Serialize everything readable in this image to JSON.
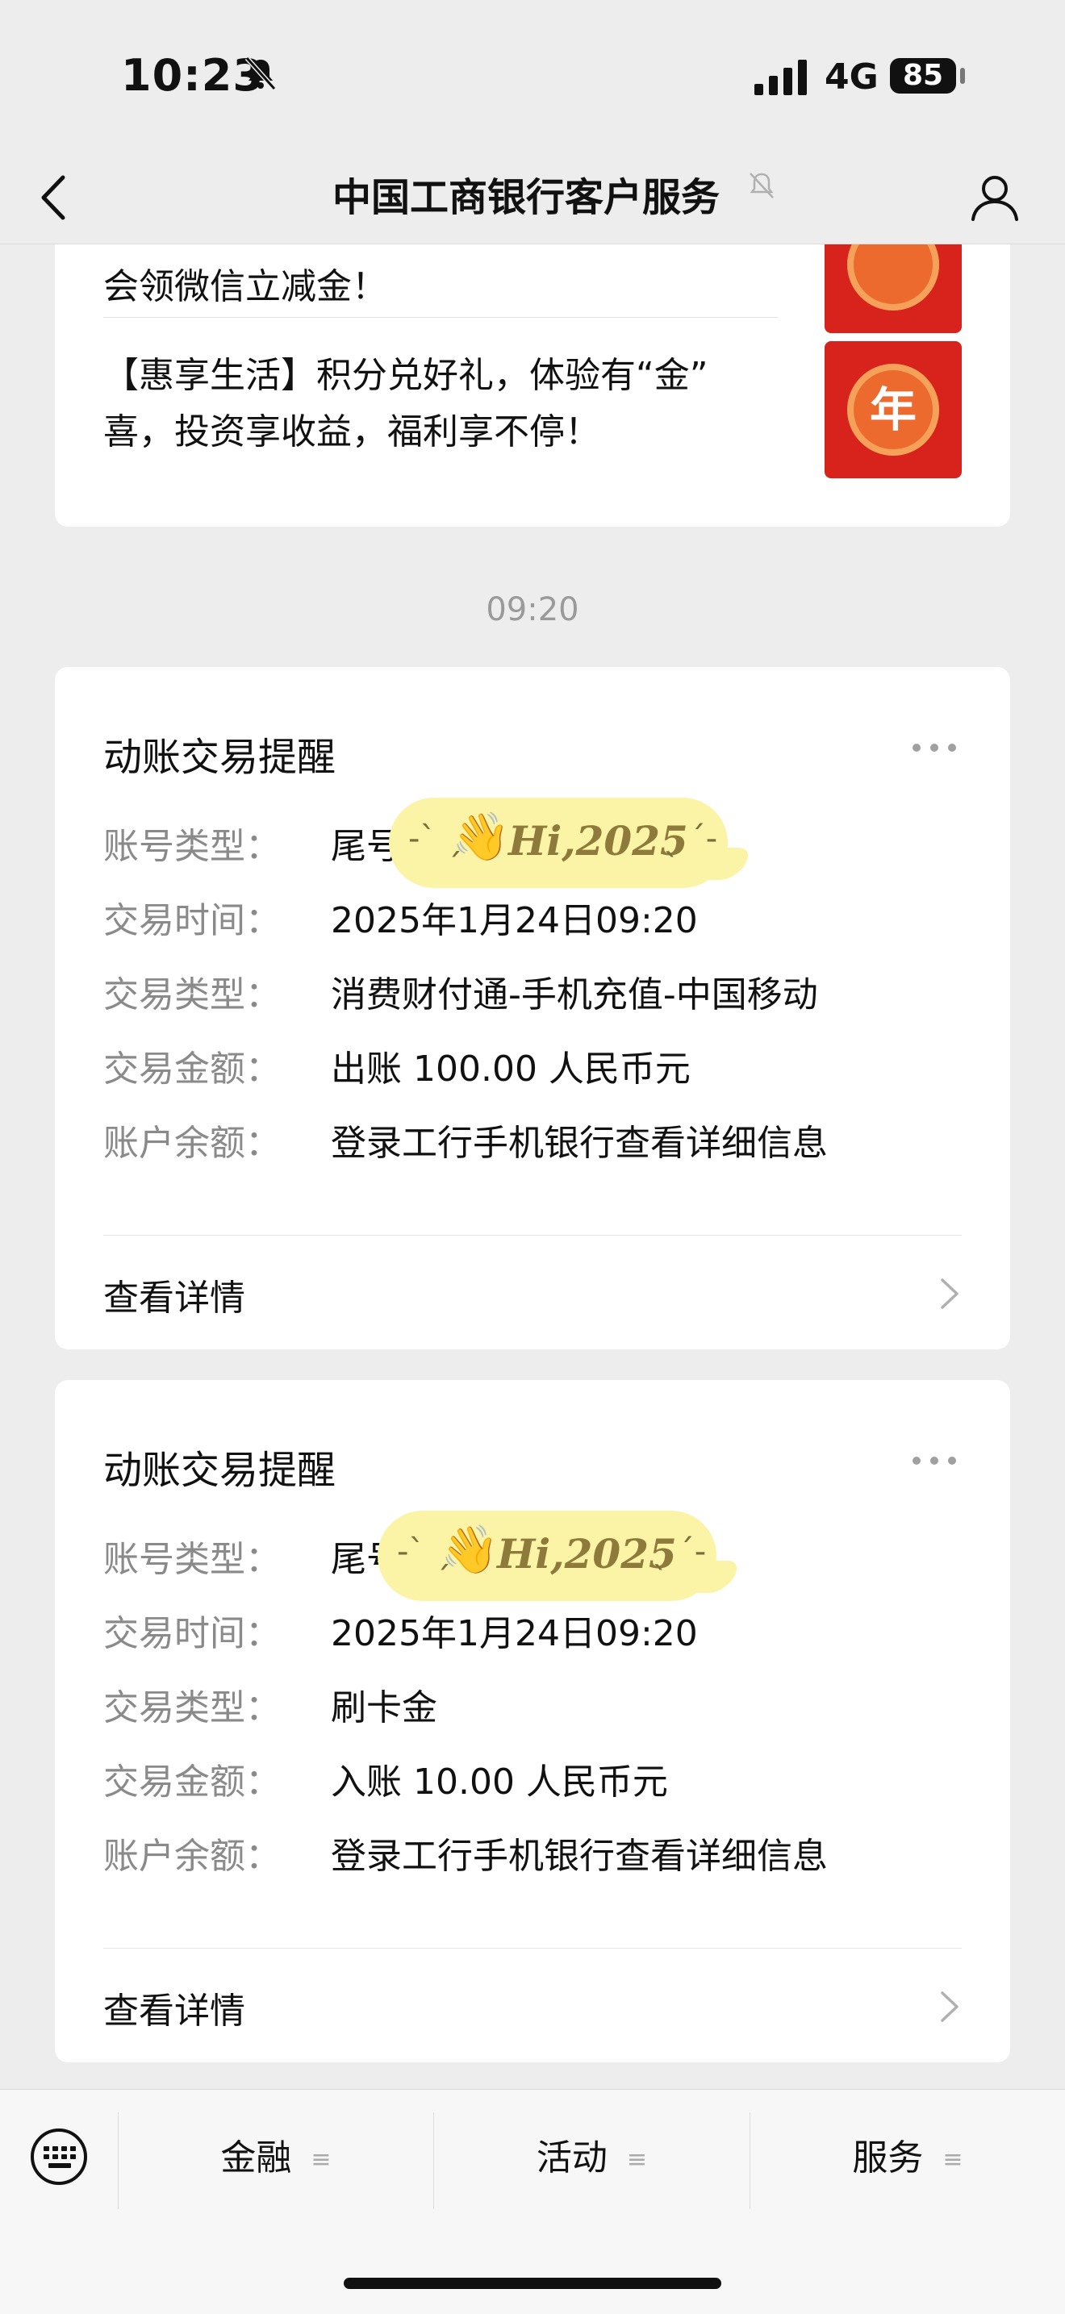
{
  "status_bar": {
    "time": "10:23",
    "network": "4G",
    "battery": "85",
    "icons": [
      "bell-muted-icon",
      "signal-icon",
      "battery-icon"
    ]
  },
  "nav": {
    "title": "中国工商银行客户服务",
    "icons": [
      "back-icon",
      "muted-bell-icon",
      "user-icon"
    ]
  },
  "news": {
    "item1_tail": "会领微信立减金！",
    "item2_line1": "【惠享生活】积分兑好礼，体验有“金”",
    "item2_line2": "喜，投资享收益，福利享不停！",
    "thumb_char": "年"
  },
  "timestamp": "09:20",
  "sticker": {
    "prefix": "尾号",
    "left_dash": "-ˋ ˏ",
    "hi": "Hi,2025",
    "right_dash": "ˎ ˊ-"
  },
  "transactions": [
    {
      "title": "动账交易提醒",
      "rows": [
        {
          "label": "账号类型：",
          "value": "尾号"
        },
        {
          "label": "交易时间：",
          "value": "2025年1月24日09:20"
        },
        {
          "label": "交易类型：",
          "value": "消费财付通-手机充值-中国移动"
        },
        {
          "label": "交易金额：",
          "value": "出账 100.00 人民币元"
        },
        {
          "label": "账户余额：",
          "value": "登录工行手机银行查看详细信息"
        }
      ],
      "detail": "查看详情"
    },
    {
      "title": "动账交易提醒",
      "rows": [
        {
          "label": "账号类型：",
          "value": "尾号"
        },
        {
          "label": "交易时间：",
          "value": "2025年1月24日09:20"
        },
        {
          "label": "交易类型：",
          "value": "刷卡金"
        },
        {
          "label": "交易金额：",
          "value": "入账 10.00 人民币元"
        },
        {
          "label": "账户余额：",
          "value": "登录工行手机银行查看详细信息"
        }
      ],
      "detail": "查看详情"
    }
  ],
  "bottom_menu": {
    "items": [
      "金融",
      "活动",
      "服务"
    ],
    "menu_icon": "≡"
  },
  "colors": {
    "background": "#ededed",
    "card": "#ffffff",
    "label_gray": "#8a8a8a",
    "sticker_yellow": "#fbf3a6",
    "thumb_red": "#d8231c"
  }
}
